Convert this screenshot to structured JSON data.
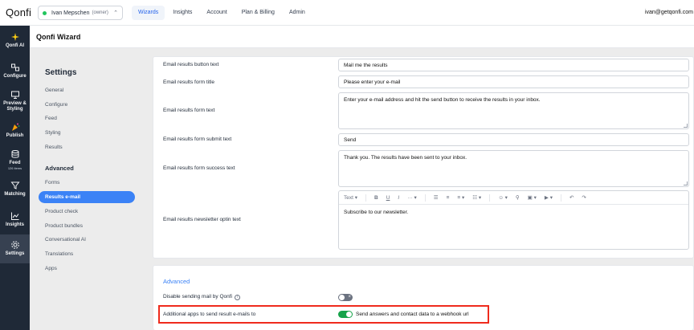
{
  "brand": {
    "logo": "Qonfi"
  },
  "org_selector": {
    "name": "Ivan Mepschen",
    "role": "(owner)"
  },
  "top_nav": [
    {
      "label": "Wizards",
      "active": true
    },
    {
      "label": "Insights",
      "active": false
    },
    {
      "label": "Account",
      "active": false
    },
    {
      "label": "Plan & Billing",
      "active": false
    },
    {
      "label": "Admin",
      "active": false
    }
  ],
  "user": {
    "email": "ivan@getqonfi.com"
  },
  "rail": [
    {
      "label": "Qonfi AI",
      "icon": "sparkles-icon"
    },
    {
      "label": "Configure",
      "icon": "sliders-icon"
    },
    {
      "label": "Preview & Styling",
      "icon": "monitor-icon"
    },
    {
      "label": "Publish",
      "icon": "party-icon"
    },
    {
      "label": "Feed",
      "sub": "126 items",
      "icon": "database-icon"
    },
    {
      "label": "Matching",
      "icon": "filter-icon"
    },
    {
      "label": "Insights",
      "icon": "chart-icon"
    },
    {
      "label": "Settings",
      "icon": "gear-icon",
      "active": true
    }
  ],
  "page": {
    "title": "Qonfi Wizard"
  },
  "settings": {
    "heading": "Settings",
    "general_links": [
      "General",
      "Configure",
      "Feed",
      "Styling",
      "Results"
    ],
    "advanced_heading": "Advanced",
    "advanced_links": [
      "Forms",
      "Results e-mail",
      "Product check",
      "Product bundles",
      "Conversational AI",
      "Translations",
      "Apps"
    ],
    "active_link": "Results e-mail"
  },
  "email_form": {
    "button_text": {
      "label": "Email results button text",
      "value": "Mail me the results"
    },
    "form_title": {
      "label": "Email results form title",
      "value": "Please enter your e-mail"
    },
    "form_text": {
      "label": "Email results form text",
      "value": "Enter your e-mail address and hit the send button to receive the results in your inbox."
    },
    "submit_text": {
      "label": "Email results form submit text",
      "value": "Send"
    },
    "success_text": {
      "label": "Email results form success text",
      "value": "Thank you. The results have been sent to your inbox."
    },
    "newsletter_text": {
      "label": "Email results newsletter optin text",
      "value": "Subscribe to our newsletter."
    }
  },
  "editor_toolbar": {
    "style_dropdown": "Text"
  },
  "advanced": {
    "title": "Advanced",
    "disable_sending": {
      "label": "Disable sending mail by Qonfi",
      "enabled": false
    },
    "additional_apps": {
      "label": "Additional apps to send result e-mails to",
      "enabled": true,
      "option_text": "Send answers and contact data to a webhook url"
    }
  },
  "colors": {
    "accent": "#3b82f6",
    "rail_bg": "#1f2937",
    "toggle_on": "#16a34a",
    "highlight": "#ef2b1d"
  }
}
